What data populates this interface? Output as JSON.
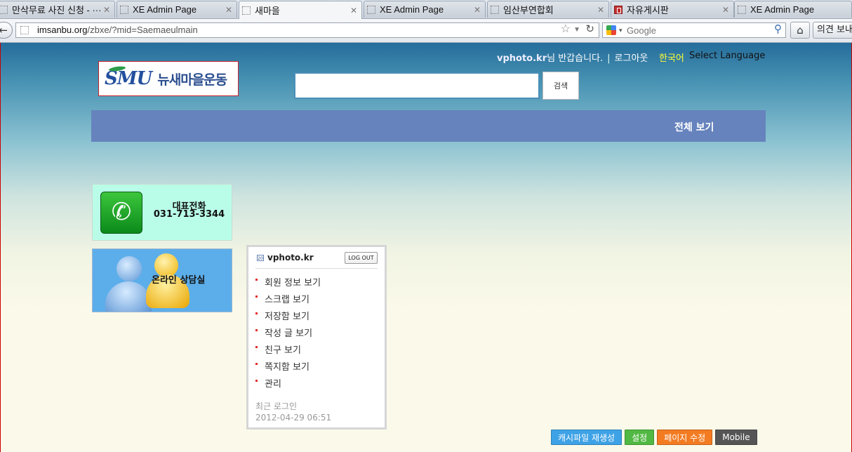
{
  "browser": {
    "tabs": [
      {
        "label": "만삭무료 사진 신청 - ···",
        "active": false,
        "icon": "blank-page-icon"
      },
      {
        "label": "XE Admin Page",
        "active": false,
        "icon": "blank-page-icon"
      },
      {
        "label": "새마을",
        "active": true,
        "icon": "blank-page-icon"
      },
      {
        "label": "XE Admin Page",
        "active": false,
        "icon": "blank-page-icon"
      },
      {
        "label": "임산부연합회",
        "active": false,
        "icon": "blank-page-icon"
      },
      {
        "label": "자유게시판",
        "active": false,
        "icon": "board-icon"
      },
      {
        "label": "XE Admin Page",
        "active": false,
        "icon": "blank-page-icon"
      }
    ],
    "url_host": "imsanbu.org",
    "url_path": "/zbxe/?mid=Saemaeulmain",
    "search_placeholder": "Google",
    "feedback_label": "의견 보내기"
  },
  "header": {
    "user_id": "vphoto.kr",
    "greeting": "님 반갑습니다.",
    "logout_link": "로그아웃",
    "lang_current": "한국어",
    "lang_select": "Select Language",
    "logo_mark": "SMU",
    "logo_text": "뉴새마을운동",
    "search_button": "검색",
    "menu_all": "전체 보기"
  },
  "phone_box": {
    "title": "대표전화",
    "number": "031-713-3344"
  },
  "consult_box": {
    "label": "온라인 상담실"
  },
  "login_widget": {
    "user_id": "vphoto.kr",
    "logout_button": "LOG OUT",
    "menu": [
      "회원 정보 보기",
      "스크랩 보기",
      "저장함 보기",
      "작성 글 보기",
      "친구 보기",
      "쪽지함 보기",
      "관리"
    ],
    "last_login_label": "최근 로그인",
    "last_login_time": "2012-04-29 06:51"
  },
  "admin_buttons": {
    "cache": "캐시파일 재생성",
    "settings": "설정",
    "edit_page": "페이지 수정",
    "mobile": "Mobile"
  },
  "colors": {
    "header_gradient_top": "#256d9b",
    "menu_bar": "#6683bd",
    "phone_box_bg": "#b9fde9",
    "consult_box_bg": "#5caeea",
    "btn_cache": "#3ea2e6",
    "btn_settings": "#51b843",
    "btn_edit": "#f37b21",
    "btn_mobile": "#555555"
  }
}
